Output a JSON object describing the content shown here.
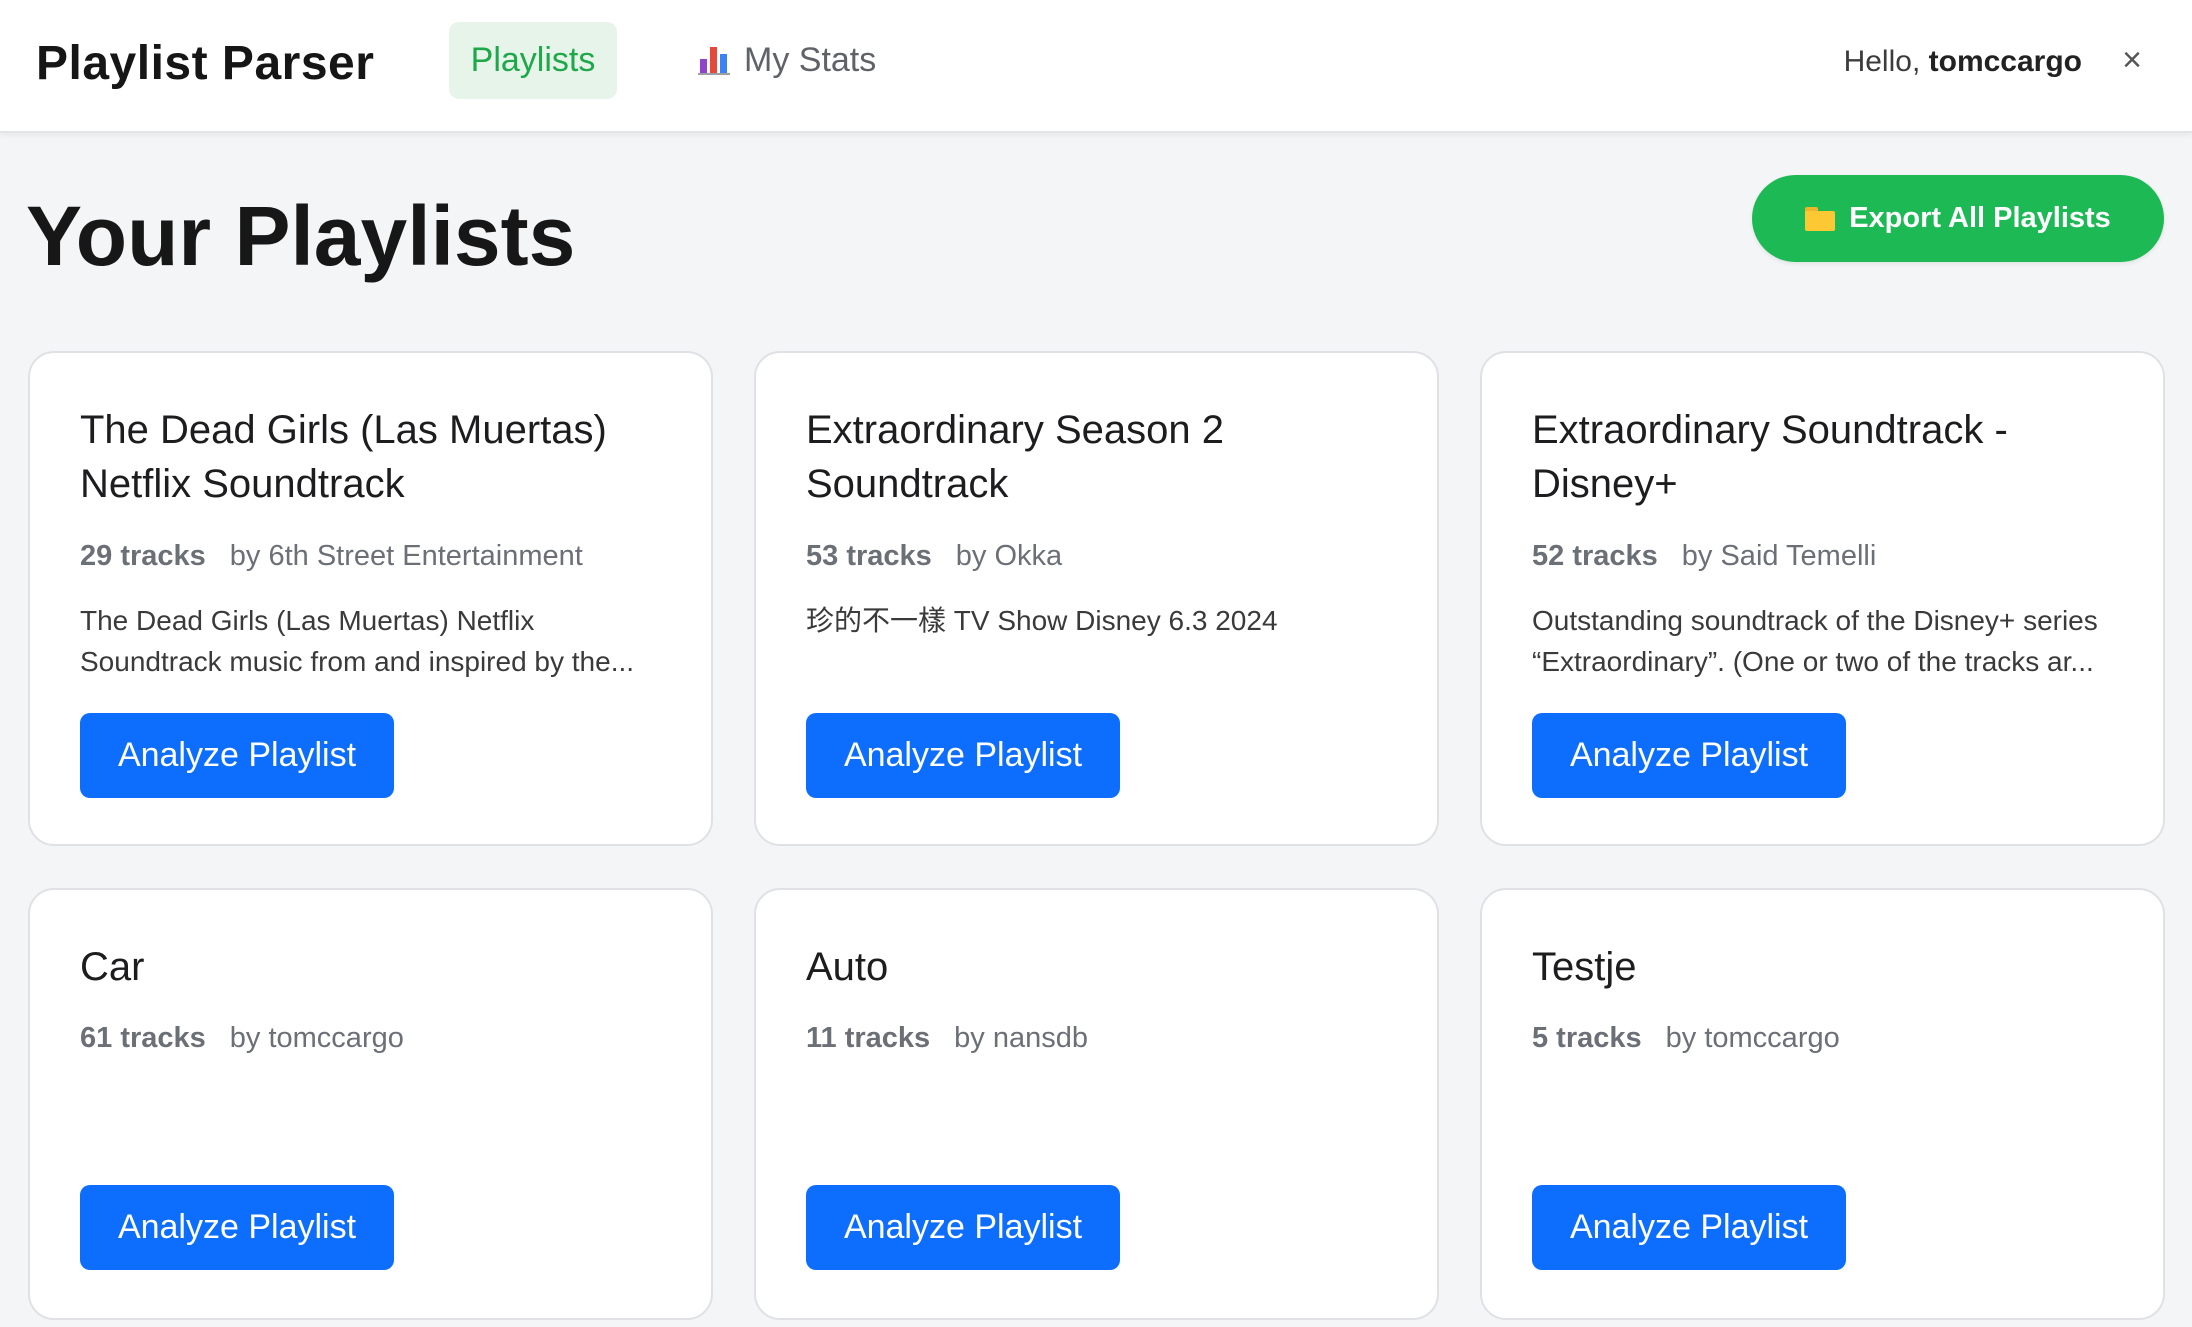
{
  "header": {
    "brand": "Playlist Parser",
    "nav": {
      "playlists_label": "Playlists",
      "stats_label": "My Stats",
      "stats_icon": "bar-chart-icon"
    },
    "greeting_prefix": "Hello,",
    "username": "tomccargo",
    "close_label": "×"
  },
  "page": {
    "title": "Your Playlists",
    "export_label": "Export All Playlists",
    "export_icon": "folder-icon"
  },
  "colors": {
    "accent_green": "#1db954",
    "active_tab_bg": "#e6f4ea",
    "active_tab_text": "#1ea84a",
    "button_blue": "#0d6efd"
  },
  "playlists": [
    {
      "title": "The Dead Girls (Las Muertas) Netflix Soundtrack",
      "tracks": "29 tracks",
      "owner": "by 6th Street Entertainment",
      "description": "The Dead Girls (Las Muertas) Netflix Soundtrack music from and inspired by the...",
      "button": "Analyze Playlist"
    },
    {
      "title": "Extraordinary Season 2 Soundtrack",
      "tracks": "53 tracks",
      "owner": "by Okka",
      "description": "珍的不一樣 TV Show Disney 6.3 2024",
      "button": "Analyze Playlist"
    },
    {
      "title": "Extraordinary Soundtrack - Disney+",
      "tracks": "52 tracks",
      "owner": "by Said Temelli",
      "description": "Outstanding soundtrack of the Disney+ series “Extraordinary”. (One or two of the tracks ar...",
      "button": "Analyze Playlist"
    },
    {
      "title": "Car",
      "tracks": "61 tracks",
      "owner": "by tomccargo",
      "description": "",
      "button": "Analyze Playlist"
    },
    {
      "title": "Auto",
      "tracks": "11 tracks",
      "owner": "by nansdb",
      "description": "",
      "button": "Analyze Playlist"
    },
    {
      "title": "Testje",
      "tracks": "5 tracks",
      "owner": "by tomccargo",
      "description": "",
      "button": "Analyze Playlist"
    }
  ]
}
